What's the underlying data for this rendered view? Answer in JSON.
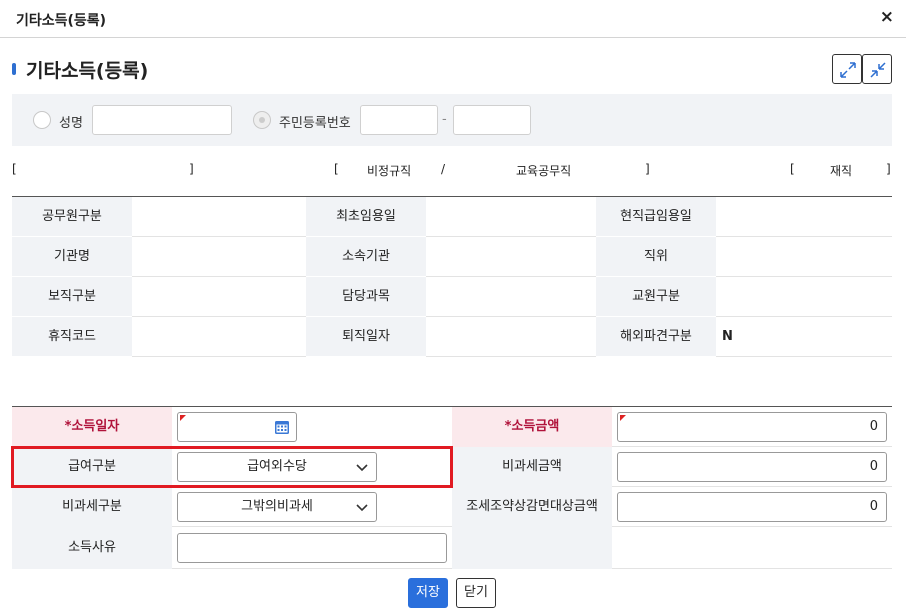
{
  "window": {
    "title": "기타소득(등록)",
    "close_icon": "×"
  },
  "page": {
    "title": "기타소득(등록)"
  },
  "search": {
    "radio_name_label": "성명",
    "radio_rrn_label": "주민등록번호",
    "rrn_separator": "-",
    "name_value": "",
    "rrn1_value": "",
    "rrn2_value": ""
  },
  "status": {
    "open1": "[",
    "close1": "]",
    "open2": "[",
    "type1": "비정규직",
    "slash": "/",
    "type2": "교육공무직",
    "close2": "]",
    "open3": "[",
    "state": "재직",
    "close3": "]"
  },
  "info": {
    "rows": [
      [
        {
          "label": "공무원구분",
          "value": ""
        },
        {
          "label": "최초임용일",
          "value": ""
        },
        {
          "label": "현직급임용일",
          "value": ""
        }
      ],
      [
        {
          "label": "기관명",
          "value": ""
        },
        {
          "label": "소속기관",
          "value": ""
        },
        {
          "label": "직위",
          "value": ""
        }
      ],
      [
        {
          "label": "보직구분",
          "value": ""
        },
        {
          "label": "담당과목",
          "value": ""
        },
        {
          "label": "교원구분",
          "value": ""
        }
      ],
      [
        {
          "label": "휴직코드",
          "value": ""
        },
        {
          "label": "퇴직일자",
          "value": ""
        },
        {
          "label": "해외파견구분",
          "value": "N"
        }
      ]
    ]
  },
  "form": {
    "income_date_label": "*소득일자",
    "income_date_value": "",
    "income_amount_label": "*소득금액",
    "income_amount_value": "0",
    "pay_type_label": "급여구분",
    "pay_type_value": "급여외수당",
    "nontax_amount_label": "비과세금액",
    "nontax_amount_value": "0",
    "nontax_type_label": "비과세구분",
    "nontax_type_value": "그밖의비과세",
    "treaty_label": "조세조약상감면대상금액",
    "treaty_value": "0",
    "reason_label": "소득사유",
    "reason_value": ""
  },
  "buttons": {
    "save": "저장",
    "close": "닫기"
  },
  "colors": {
    "accent": "#2a6fdc",
    "required_bg": "#fbe9ec",
    "required_text": "#b0123a",
    "highlight": "#e11a22"
  }
}
